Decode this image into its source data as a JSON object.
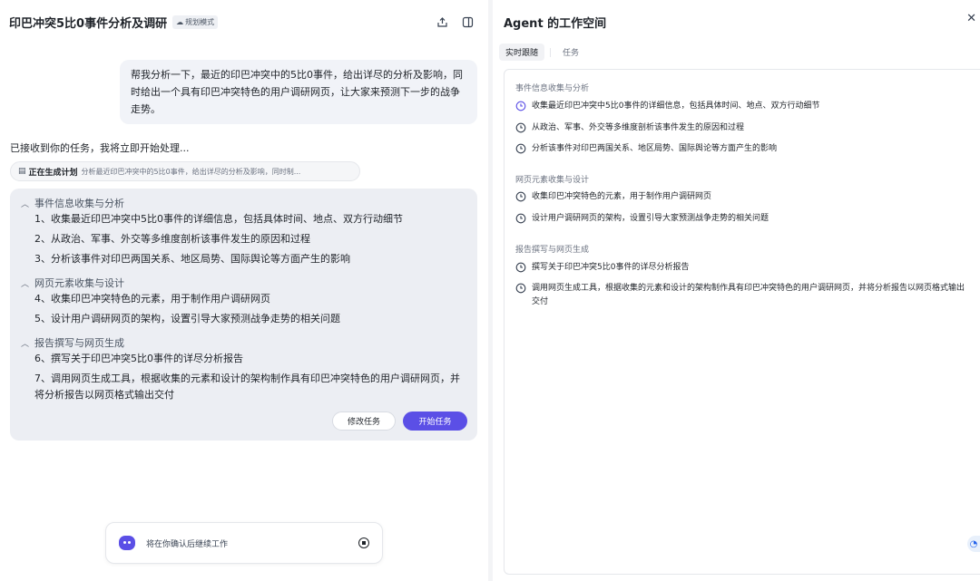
{
  "chat": {
    "title": "印巴冲突5比0事件分析及调研",
    "mode_badge": "规划模式",
    "user_message": "帮我分析一下，最近的印巴冲突中的5比0事件，给出详尽的分析及影响，同时给出一个具有印巴冲突特色的用户调研网页，让大家来预测下一步的战争走势。",
    "ack_text": "已接收到你的任务，我将立即开始处理...",
    "generating": {
      "label": "正在生成计划",
      "text": "分析最近印巴冲突中的5比0事件，给出详尽的分析及影响，同时制..."
    },
    "plan": {
      "sections": [
        {
          "title": "事件信息收集与分析",
          "tasks": [
            "1、收集最近印巴冲突中5比0事件的详细信息，包括具体时间、地点、双方行动细节",
            "2、从政治、军事、外交等多维度剖析该事件发生的原因和过程",
            "3、分析该事件对印巴两国关系、地区局势、国际舆论等方面产生的影响"
          ]
        },
        {
          "title": "网页元素收集与设计",
          "tasks": [
            "4、收集印巴冲突特色的元素，用于制作用户调研网页",
            "5、设计用户调研网页的架构，设置引导大家预测战争走势的相关问题"
          ]
        },
        {
          "title": "报告撰写与网页生成",
          "tasks": [
            "6、撰写关于印巴冲突5比0事件的详尽分析报告",
            "7、调用网页生成工具，根据收集的元素和设计的架构制作具有印巴冲突特色的用户调研网页，并将分析报告以网页格式输出交付"
          ]
        }
      ],
      "edit_label": "修改任务",
      "start_label": "开始任务"
    },
    "bottom_status": "将在你确认后继续工作"
  },
  "workspace": {
    "title": "Agent 的工作空间",
    "tabs": [
      {
        "label": "实时跟随",
        "active": true
      },
      {
        "label": "任务",
        "active": false
      }
    ],
    "sections": [
      {
        "title": "事件信息收集与分析",
        "items": [
          "收集最近印巴冲突中5比0事件的详细信息，包括具体时间、地点、双方行动细节",
          "从政治、军事、外交等多维度剖析该事件发生的原因和过程",
          "分析该事件对印巴两国关系、地区局势、国际舆论等方面产生的影响"
        ]
      },
      {
        "title": "网页元素收集与设计",
        "items": [
          "收集印巴冲突特色的元素，用于制作用户调研网页",
          "设计用户调研网页的架构，设置引导大家预测战争走势的相关问题"
        ]
      },
      {
        "title": "报告撰写与网页生成",
        "items": [
          "撰写关于印巴冲突5比0事件的详尽分析报告",
          "调用网页生成工具，根据收集的元素和设计的架构制作具有印巴冲突特色的用户调研网页，并将分析报告以网页格式输出交付"
        ]
      }
    ]
  },
  "colors": {
    "accent": "#5b4fe6",
    "active_clock": "#5b4fe6"
  },
  "icons": {
    "share": "share-icon",
    "panel": "panel-toggle-icon",
    "close": "close-icon",
    "clock": "clock-icon",
    "chevron": "chevron-up-icon",
    "bot": "bot-avatar-icon",
    "stop": "stop-icon"
  }
}
